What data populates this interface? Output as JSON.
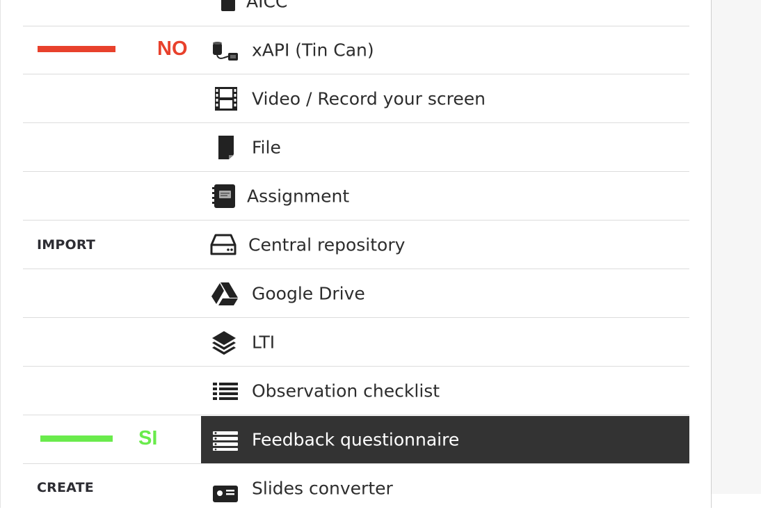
{
  "menu": {
    "items": [
      {
        "label": "AICC",
        "icon": "aicc-icon"
      },
      {
        "label": "xAPI (Tin Can)",
        "icon": "tin-can-icon"
      },
      {
        "label": "Video / Record your screen",
        "icon": "film-icon"
      },
      {
        "label": "File",
        "icon": "file-icon"
      },
      {
        "label": "Assignment",
        "icon": "notebook-icon"
      },
      {
        "label": "Central repository",
        "icon": "hard-drive-icon"
      },
      {
        "label": "Google Drive",
        "icon": "google-drive-icon"
      },
      {
        "label": "LTI",
        "icon": "layers-icon"
      },
      {
        "label": "Observation checklist",
        "icon": "list-icon"
      },
      {
        "label": "Feedback questionnaire",
        "icon": "list-checks-icon",
        "selected": true
      },
      {
        "label": "Slides converter",
        "icon": "slides-icon"
      }
    ],
    "sections": {
      "import": "IMPORT",
      "create": "CREATE"
    }
  },
  "annotations": {
    "no": {
      "text": "NO",
      "color": "#e8412c"
    },
    "si": {
      "text": "SI",
      "color": "#6aeb4c"
    }
  },
  "colors": {
    "selected_bg": "#333333",
    "separator": "#dcdcdc"
  }
}
